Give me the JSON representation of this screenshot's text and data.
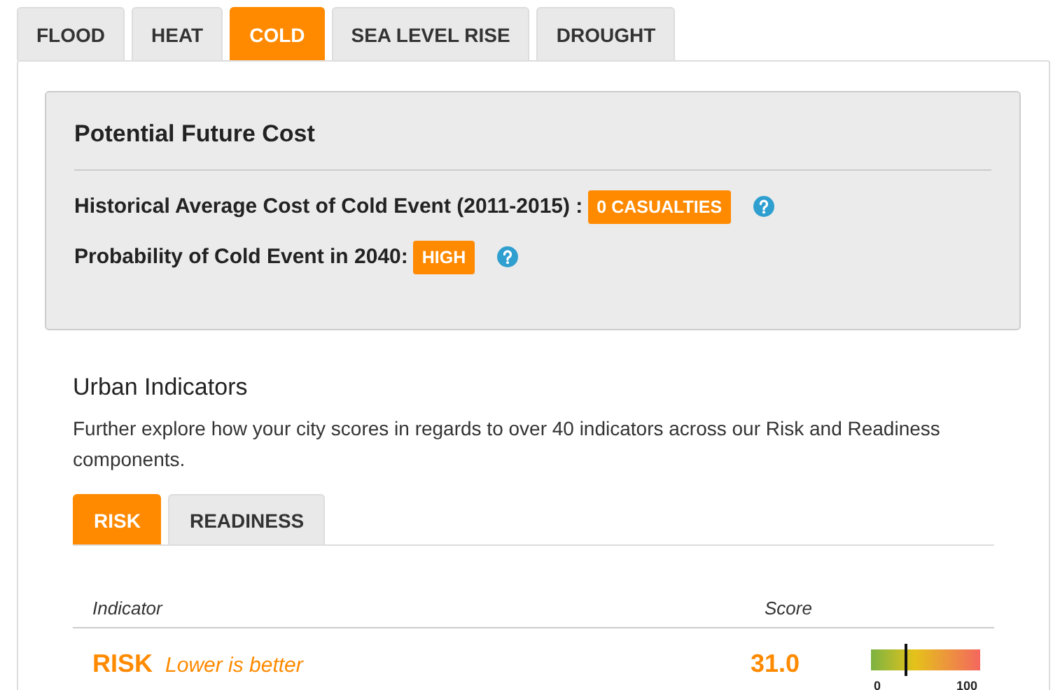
{
  "hazard_tabs": [
    {
      "label": "FLOOD",
      "selected": false
    },
    {
      "label": "HEAT",
      "selected": false
    },
    {
      "label": "COLD",
      "selected": true
    },
    {
      "label": "SEA LEVEL RISE",
      "selected": false
    },
    {
      "label": "DROUGHT",
      "selected": false
    }
  ],
  "cost_panel": {
    "title": "Potential Future Cost",
    "rows": [
      {
        "label": "Historical Average Cost of Cold Event (2011-2015) :",
        "badge": "0 CASUALTIES"
      },
      {
        "label": "Probability of Cold Event in 2040:",
        "badge": "HIGH"
      }
    ]
  },
  "urban_indicators": {
    "title": "Urban Indicators",
    "description": "Further explore how your city scores in regards to over 40 indicators across our Risk and Readiness components.",
    "tabs": [
      {
        "label": "RISK",
        "selected": true
      },
      {
        "label": "READINESS",
        "selected": false
      }
    ],
    "table": {
      "columns": [
        "Indicator",
        "Score"
      ],
      "rows": [
        {
          "name": "RISK",
          "note": "Lower is better",
          "score": "31.0",
          "level": 0.31,
          "scale_min": "0",
          "scale_max": "100"
        }
      ]
    }
  }
}
